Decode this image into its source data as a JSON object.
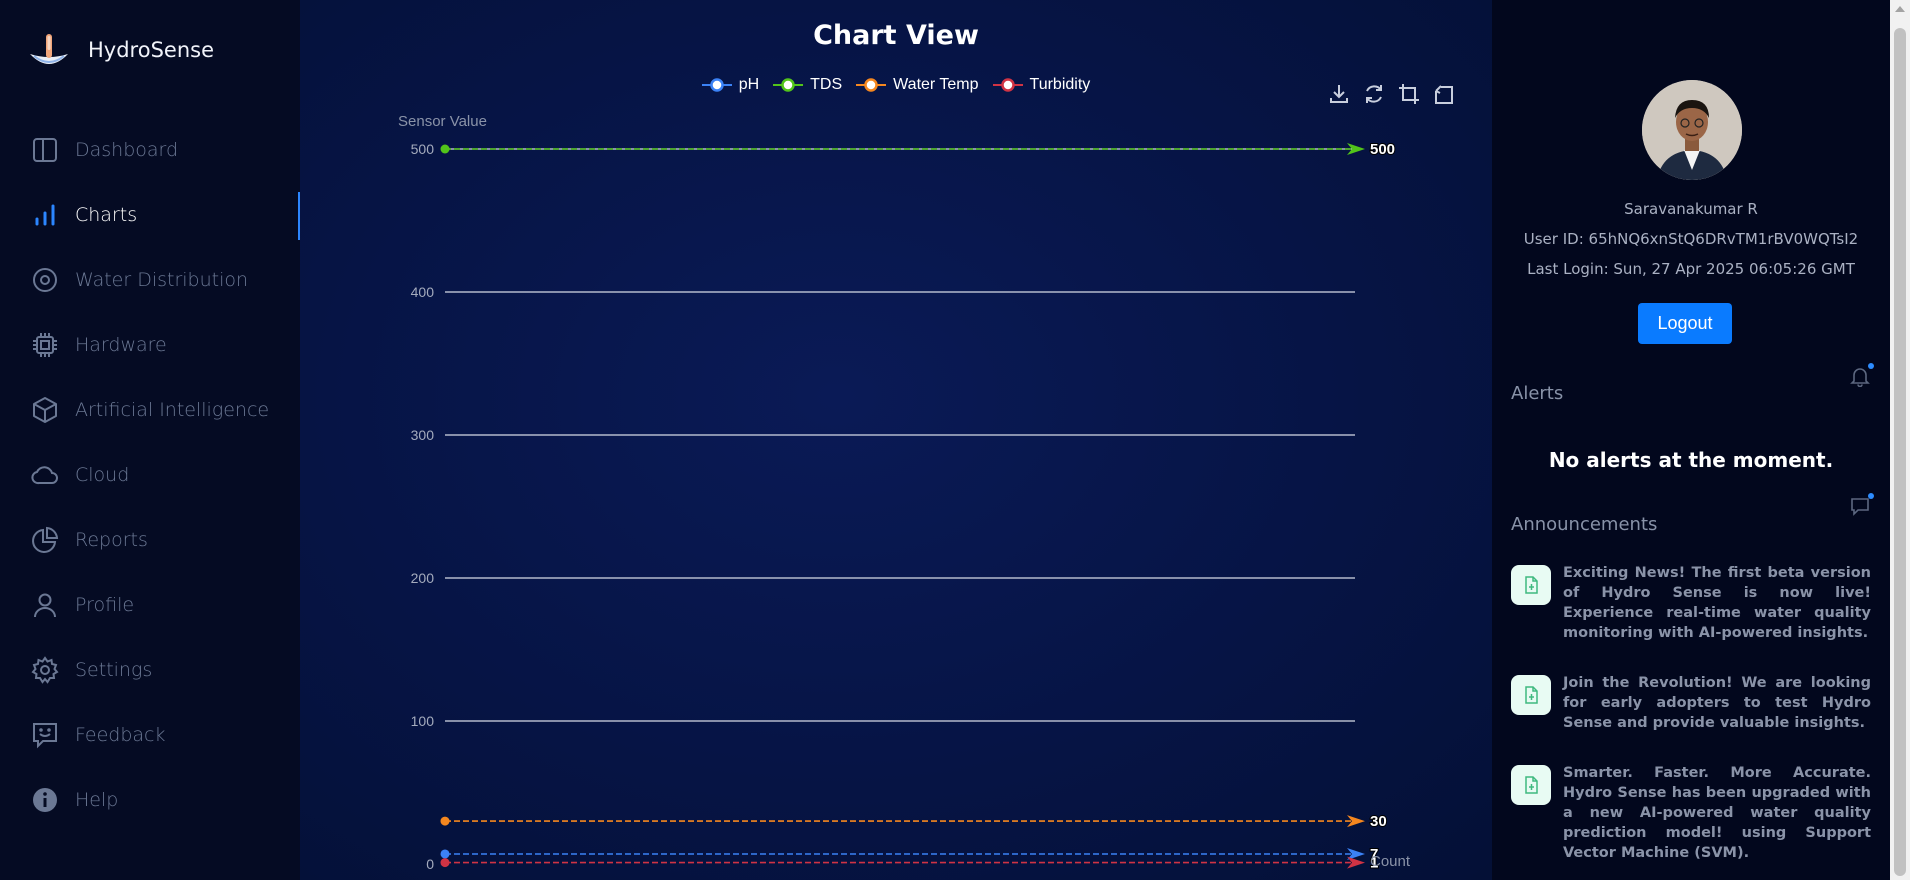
{
  "app": {
    "name": "HydroSense"
  },
  "sidebar": {
    "items": [
      {
        "label": "Dashboard",
        "icon": "dashboard-icon",
        "active": false
      },
      {
        "label": "Charts",
        "icon": "bar-chart-icon",
        "active": true
      },
      {
        "label": "Water Distribution",
        "icon": "target-icon",
        "active": false
      },
      {
        "label": "Hardware",
        "icon": "chip-icon",
        "active": false
      },
      {
        "label": "Artificial Intelligence",
        "icon": "cube-icon",
        "active": false
      },
      {
        "label": "Cloud",
        "icon": "cloud-icon",
        "active": false
      },
      {
        "label": "Reports",
        "icon": "pie-chart-icon",
        "active": false
      },
      {
        "label": "Profile",
        "icon": "user-icon",
        "active": false
      },
      {
        "label": "Settings",
        "icon": "gear-icon",
        "active": false
      },
      {
        "label": "Feedback",
        "icon": "feedback-icon",
        "active": false
      },
      {
        "label": "Help",
        "icon": "info-icon",
        "active": false
      }
    ]
  },
  "main": {
    "title": "Chart View"
  },
  "colors": {
    "ph": "#3b82f6",
    "tds": "#52c41a",
    "water_temp": "#f5871f",
    "turbidity": "#d03344",
    "accent": "#0a7bff"
  },
  "chart_data": {
    "type": "line",
    "title": "Chart View",
    "xlabel": "Count",
    "ylabel": "Sensor Value",
    "ylim": [
      0,
      500
    ],
    "yticks": [
      0,
      100,
      200,
      300,
      400,
      500
    ],
    "grid": true,
    "legend": "top-center",
    "series": [
      {
        "name": "pH",
        "values": [
          7,
          7
        ],
        "end_label": "7"
      },
      {
        "name": "TDS",
        "values": [
          500,
          500
        ],
        "end_label": "500"
      },
      {
        "name": "Water Temp",
        "values": [
          30,
          30
        ],
        "end_label": "30"
      },
      {
        "name": "Turbidity",
        "values": [
          1,
          1
        ],
        "end_label": "1"
      }
    ]
  },
  "user": {
    "name": "Saravanakumar R",
    "id_text": "User ID: 65hNQ6xnStQ6DRvTM1rBV0WQTsI2",
    "last_login": "Last Login: Sun, 27 Apr 2025 06:05:26 GMT",
    "logout_label": "Logout"
  },
  "alerts": {
    "title": "Alerts",
    "empty_text": "No alerts at the moment."
  },
  "announcements": {
    "title": "Announcements",
    "items": [
      "Exciting News! The first beta version of Hydro Sense is now live! Experience real-time water quality monitoring with AI-powered insights.",
      "Join the Revolution! We are looking for early adopters to test Hydro Sense and provide valuable insights.",
      "Smarter. Faster. More Accurate. Hydro Sense has been upgraded with a new AI-powered water quality prediction model! using Support Vector Machine (SVM)."
    ]
  }
}
